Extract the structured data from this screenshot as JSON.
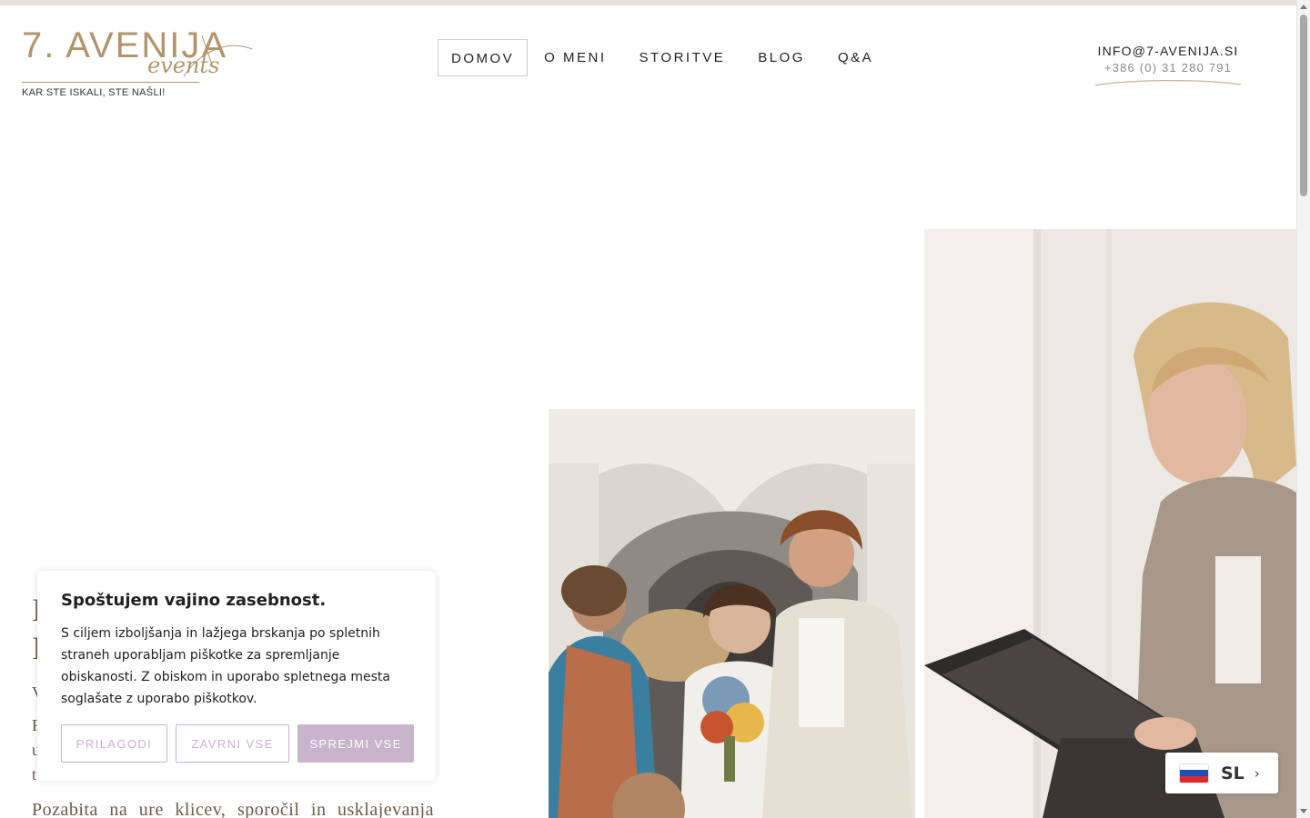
{
  "brand": {
    "logo_main": "7. AVENIJA",
    "logo_script": "events",
    "tagline": "KAR STE ISKALI, STE NAŠLI!",
    "accent_color": "#b3946a"
  },
  "nav": {
    "items": [
      {
        "label": "DOMOV",
        "active": true
      },
      {
        "label": "O MENI"
      },
      {
        "label": "STORITVE"
      },
      {
        "label": "BLOG"
      },
      {
        "label": "Q&A"
      }
    ]
  },
  "contact": {
    "email": "INFO@7-AVENIJA.SI",
    "phone": "+386 (0) 31 280 791"
  },
  "hero": {
    "peek_words": [
      "Pozabita",
      "na",
      "ure",
      "klicev,",
      "sporočil",
      "in",
      "usklajevanja"
    ]
  },
  "cookie": {
    "title": "Spoštujem vajino zasebnost.",
    "text": "S ciljem izboljšanja in lažjega brskanja po spletnih straneh uporabljam piškotke za spremljanje obiskanosti. Z obiskom in uporabo spletnega mesta soglašate z uporabo piškotkov.",
    "customize_label": "PRILAGODI",
    "reject_label": "ZAVRNI VSE",
    "accept_label": "SPREJMI VSE",
    "accent_color": "#c9b3cd"
  },
  "language": {
    "code": "SL",
    "flag": "slovenia-flag-icon",
    "chevron": "›"
  }
}
